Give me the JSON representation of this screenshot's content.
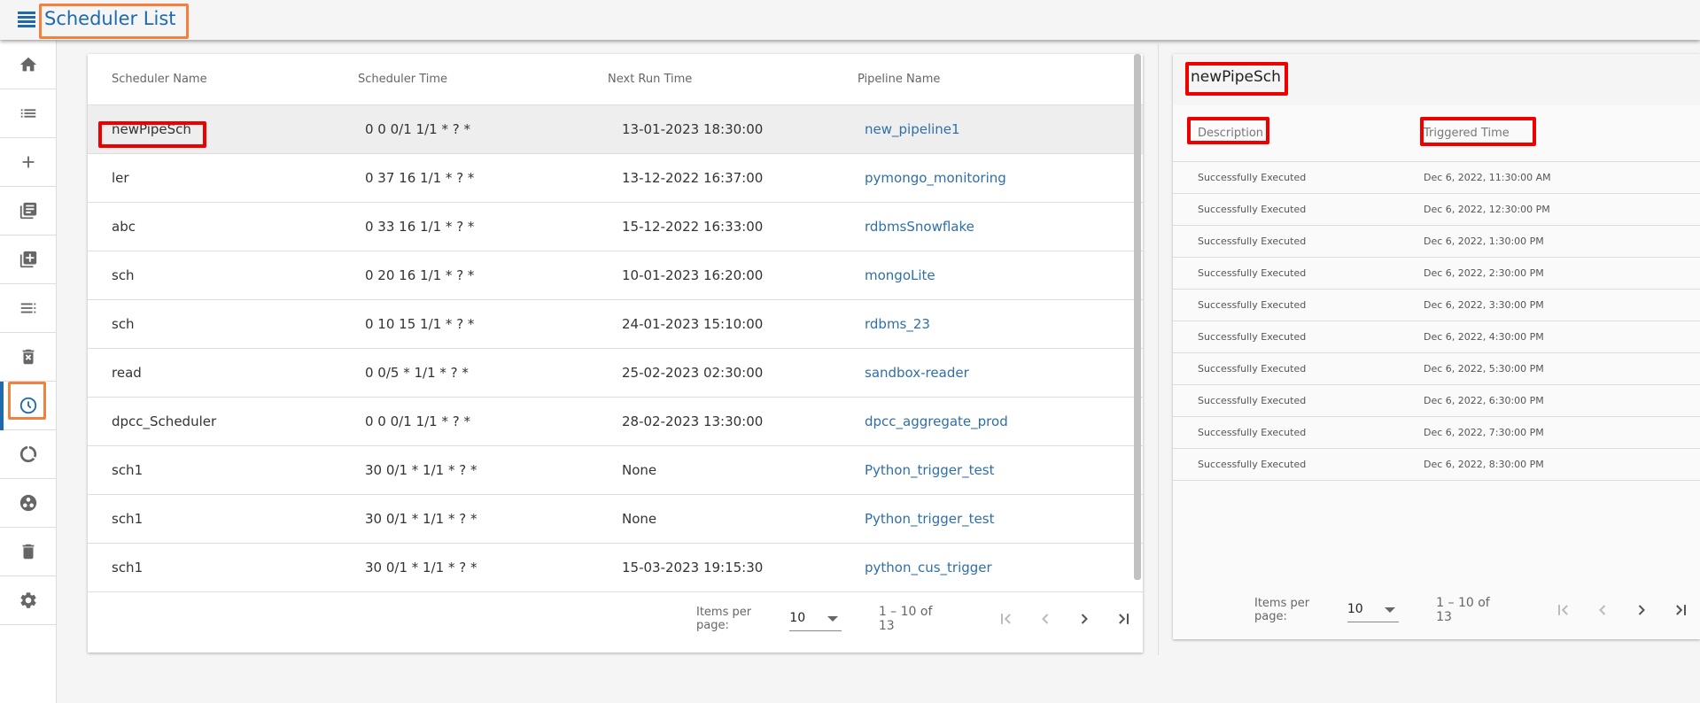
{
  "header": {
    "title": "Scheduler List"
  },
  "sidebar": {
    "items": [
      {
        "icon": "home-icon"
      },
      {
        "icon": "list-icon"
      },
      {
        "icon": "plus-icon"
      },
      {
        "icon": "library-icon"
      },
      {
        "icon": "library-add-icon"
      },
      {
        "icon": "playlist-icon"
      },
      {
        "icon": "delete-x-icon"
      },
      {
        "icon": "clock-icon",
        "active": true
      },
      {
        "icon": "progress-circle-icon"
      },
      {
        "icon": "group-icon"
      },
      {
        "icon": "trash-icon"
      },
      {
        "icon": "settings-icon"
      }
    ]
  },
  "schedulers": {
    "columns": [
      "Scheduler Name",
      "Scheduler Time",
      "Next Run Time",
      "Pipeline Name"
    ],
    "rows": [
      [
        "newPipeSch",
        "0 0 0/1 1/1 * ? *",
        "13-01-2023 18:30:00",
        "new_pipeline1"
      ],
      [
        "ler",
        "0 37 16 1/1 * ? *",
        "13-12-2022 16:37:00",
        "pymongo_monitoring"
      ],
      [
        "abc",
        "0 33 16 1/1 * ? *",
        "15-12-2022 16:33:00",
        "rdbmsSnowflake"
      ],
      [
        "sch",
        "0 20 16 1/1 * ? *",
        "10-01-2023 16:20:00",
        "mongoLite"
      ],
      [
        "sch",
        "0 10 15 1/1 * ? *",
        "24-01-2023 15:10:00",
        "rdbms_23"
      ],
      [
        "read",
        "0 0/5 * 1/1 * ? *",
        "25-02-2023 02:30:00",
        "sandbox-reader"
      ],
      [
        "dpcc_Scheduler",
        "0 0 0/1 1/1 * ? *",
        "28-02-2023 13:30:00",
        "dpcc_aggregate_prod"
      ],
      [
        "sch1",
        "30 0/1 * 1/1 * ? *",
        "None",
        "Python_trigger_test"
      ],
      [
        "sch1",
        "30 0/1 * 1/1 * ? *",
        "None",
        "Python_trigger_test"
      ],
      [
        "sch1",
        "30 0/1 * 1/1 * ? *",
        "15-03-2023 19:15:30",
        "python_cus_trigger"
      ]
    ],
    "pager": {
      "label": "Items per page:",
      "size": "10",
      "range": "1 – 10 of 13"
    }
  },
  "detail": {
    "title": "newPipeSch",
    "columns": [
      "Description",
      "Triggered Time"
    ],
    "rows": [
      [
        "Successfully Executed",
        "Dec 6, 2022, 11:30:00 AM"
      ],
      [
        "Successfully Executed",
        "Dec 6, 2022, 12:30:00 PM"
      ],
      [
        "Successfully Executed",
        "Dec 6, 2022, 1:30:00 PM"
      ],
      [
        "Successfully Executed",
        "Dec 6, 2022, 2:30:00 PM"
      ],
      [
        "Successfully Executed",
        "Dec 6, 2022, 3:30:00 PM"
      ],
      [
        "Successfully Executed",
        "Dec 6, 2022, 4:30:00 PM"
      ],
      [
        "Successfully Executed",
        "Dec 6, 2022, 5:30:00 PM"
      ],
      [
        "Successfully Executed",
        "Dec 6, 2022, 6:30:00 PM"
      ],
      [
        "Successfully Executed",
        "Dec 6, 2022, 7:30:00 PM"
      ],
      [
        "Successfully Executed",
        "Dec 6, 2022, 8:30:00 PM"
      ]
    ],
    "pager": {
      "label": "Items per page:",
      "size": "10",
      "range": "1 – 10 of 13"
    }
  },
  "colors": {
    "accent": "#1e6aad",
    "highlight_red": "#ee0000",
    "highlight_orange": "#f5803e"
  }
}
